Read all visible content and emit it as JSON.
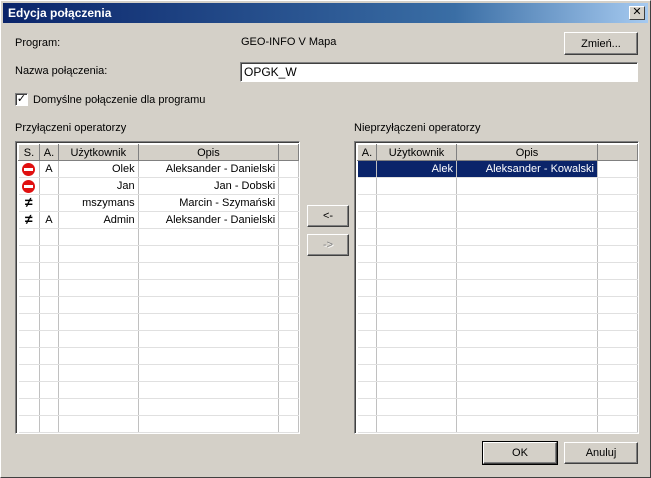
{
  "window": {
    "title": "Edycja połączenia",
    "close_glyph": "✕"
  },
  "program": {
    "label": "Program:",
    "value": "GEO-INFO V Mapa",
    "change_button": "Zmień..."
  },
  "connection": {
    "label": "Nazwa połączenia:",
    "value": "OPGK_W"
  },
  "default_checkbox": {
    "label": "Domyślne połączenie dla programu",
    "checked": true,
    "glyph": "✓"
  },
  "connected": {
    "title": "Przyłączeni operatorzy",
    "columns": [
      "S.",
      "A.",
      "Użytkownik",
      "Opis"
    ],
    "rows": [
      {
        "status_icon": "stop-icon",
        "a": "A",
        "user": "Olek",
        "desc": "Aleksander - Danielski"
      },
      {
        "status_icon": "stop-icon",
        "a": "",
        "user": "Jan",
        "desc": "Jan - Dobski"
      },
      {
        "status_icon": "not-equal-icon",
        "a": "",
        "user": "mszymans",
        "desc": "Marcin - Szymański"
      },
      {
        "status_icon": "not-equal-icon",
        "a": "A",
        "user": "Admin",
        "desc": "Aleksander - Danielski"
      }
    ]
  },
  "disconnected": {
    "title": "Nieprzyłączeni operatorzy",
    "columns": [
      "A.",
      "Użytkownik",
      "Opis"
    ],
    "rows": [
      {
        "a": "",
        "user": "Alek",
        "desc": "Aleksander - Kowalski",
        "selected": true
      }
    ]
  },
  "move_buttons": {
    "to_left": "<-",
    "to_right": "->"
  },
  "footer": {
    "ok": "OK",
    "cancel": "Anuluj"
  },
  "icons": {
    "neq_glyph": "≠"
  }
}
